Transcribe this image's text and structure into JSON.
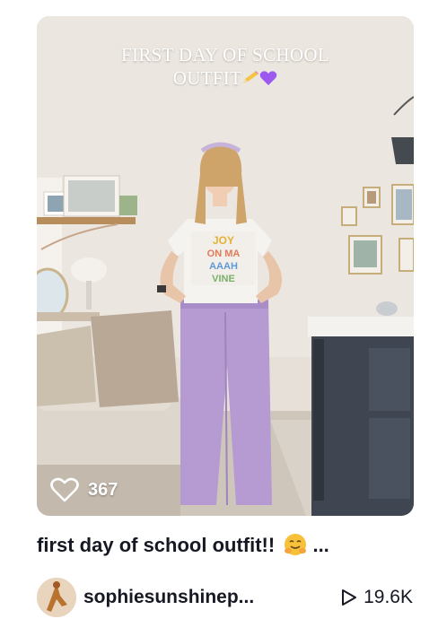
{
  "video": {
    "overlay_line1": "FIRST DAY OF SCHOOL",
    "overlay_line2": "OUTFIT",
    "overlay_emojis": [
      "pencil-emoji",
      "purple-heart-emoji"
    ],
    "shirt_text": [
      "JOY",
      "ON MA",
      "AAAH",
      "VINE"
    ],
    "like_count": "367"
  },
  "post": {
    "caption": "first day of school outfit!! ",
    "caption_emoji": "hugging-face-emoji",
    "caption_ellipsis": "...",
    "username": "sophiesunshinep...",
    "view_count": "19.6K"
  },
  "colors": {
    "caption_text": "#161823",
    "overlay_text": "#ffffff",
    "pants": "#b69bd3",
    "heart_emoji": "#9b59f0"
  }
}
